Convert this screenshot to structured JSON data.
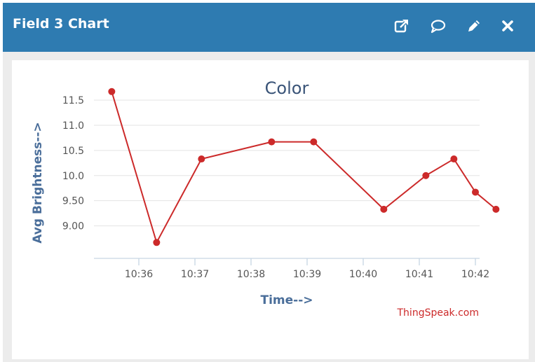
{
  "widget": {
    "title": "Field 3 Chart",
    "icons": [
      "external-link-icon",
      "comment-icon",
      "pencil-icon",
      "close-icon"
    ]
  },
  "colors": {
    "header": "#2e7bb1",
    "series": "#cc2a2a",
    "axis_title": "#4a6e9a",
    "credit": "#cc2a2a"
  },
  "chart_data": {
    "type": "line",
    "title": "Color",
    "xlabel": "Time-->",
    "ylabel": "Avg Brightness-->",
    "credit": "ThingSpeak.com",
    "x_ticks": [
      "10:36",
      "10:37",
      "10:38",
      "10:39",
      "10:40",
      "10:41",
      "10:42"
    ],
    "y_ticks": [
      "9.00",
      "9.50",
      "10.0",
      "10.5",
      "11.0",
      "11.5"
    ],
    "ylim": [
      8.5,
      11.5
    ],
    "grid": true,
    "series": [
      {
        "x": [
          "10:35:31",
          "10:36:19",
          "10:37:07",
          "10:38:22",
          "10:39:07",
          "10:40:22",
          "10:41:07",
          "10:41:37",
          "10:42:00",
          "10:42:22"
        ],
        "y": [
          11.67,
          8.67,
          10.33,
          10.67,
          10.67,
          9.33,
          10.0,
          10.33,
          9.67,
          9.33
        ]
      }
    ]
  }
}
